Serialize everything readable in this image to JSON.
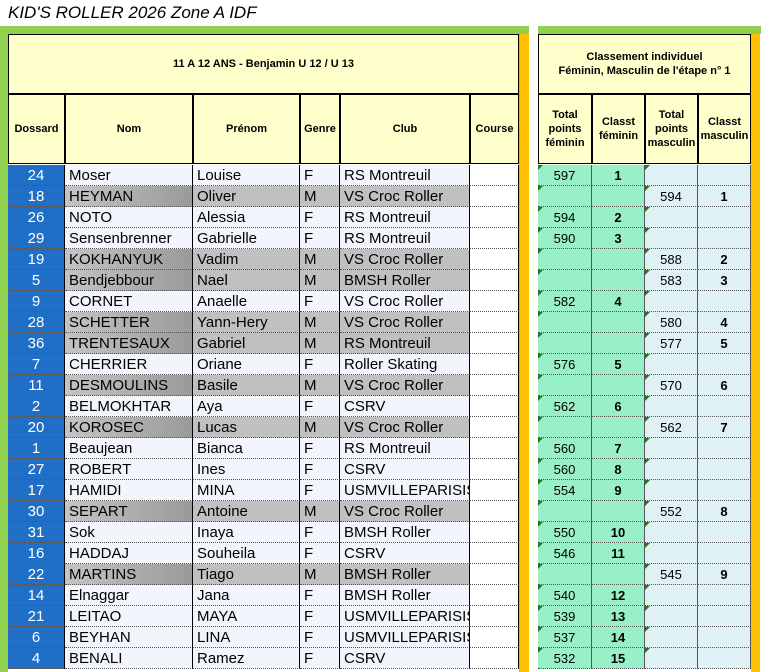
{
  "page_title": "KID'S ROLLER 2026 Zone A IDF",
  "category_header": "11 A 12 ANS - Benjamin   U 12 / U 13",
  "ranking_header": {
    "line1": "Classement individuel",
    "line2": "Féminin, Masculin de l'étape n° 1"
  },
  "columns": {
    "dossard": "Dossard",
    "nom": "Nom",
    "prenom": "Prénom",
    "genre": "Genre",
    "club": "Club",
    "course": "Course",
    "total_fem": "Total points féminin",
    "classt_fem": "Classt féminin",
    "total_masc": "Total points masculin",
    "classt_masc": "Classt masculin"
  },
  "colors": {
    "dossard_bg": "#1f6fc6",
    "header_bg": "#ffffcc",
    "fem_bg": "#99f0c8",
    "masc_bg": "#dff1f4",
    "male_row_bg": "#c0c0c0",
    "female_row_bg": "#f2f6fc",
    "green_frame": "#92d050",
    "orange_frame": "#ffc000"
  },
  "rows": [
    {
      "dossard": "24",
      "nom": "Moser",
      "prenom": "Louise",
      "genre": "F",
      "club": "RS Montreuil",
      "total_f": "597",
      "classt_f": "1",
      "total_m": "",
      "classt_m": ""
    },
    {
      "dossard": "18",
      "nom": "HEYMAN",
      "prenom": "Oliver",
      "genre": "M",
      "club": "VS Croc Roller",
      "total_f": "",
      "classt_f": "",
      "total_m": "594",
      "classt_m": "1"
    },
    {
      "dossard": "26",
      "nom": "NOTO",
      "prenom": "Alessia",
      "genre": "F",
      "club": "RS Montreuil",
      "total_f": "594",
      "classt_f": "2",
      "total_m": "",
      "classt_m": ""
    },
    {
      "dossard": "29",
      "nom": "Sensenbrenner",
      "prenom": "Gabrielle",
      "genre": "F",
      "club": "RS Montreuil",
      "total_f": "590",
      "classt_f": "3",
      "total_m": "",
      "classt_m": ""
    },
    {
      "dossard": "19",
      "nom": "KOKHANYUK",
      "prenom": "Vadim",
      "genre": "M",
      "club": "VS Croc Roller",
      "total_f": "",
      "classt_f": "",
      "total_m": "588",
      "classt_m": "2"
    },
    {
      "dossard": "5",
      "nom": "Bendjebbour",
      "prenom": "Nael",
      "genre": "M",
      "club": "BMSH Roller",
      "total_f": "",
      "classt_f": "",
      "total_m": "583",
      "classt_m": "3"
    },
    {
      "dossard": "9",
      "nom": "CORNET",
      "prenom": "Anaelle",
      "genre": "F",
      "club": "VS Croc Roller",
      "total_f": "582",
      "classt_f": "4",
      "total_m": "",
      "classt_m": ""
    },
    {
      "dossard": "28",
      "nom": "SCHETTER",
      "prenom": "Yann-Hery",
      "genre": "M",
      "club": "VS Croc Roller",
      "total_f": "",
      "classt_f": "",
      "total_m": "580",
      "classt_m": "4"
    },
    {
      "dossard": "36",
      "nom": "TRENTESAUX",
      "prenom": "Gabriel",
      "genre": "M",
      "club": "RS Montreuil",
      "total_f": "",
      "classt_f": "",
      "total_m": "577",
      "classt_m": "5"
    },
    {
      "dossard": "7",
      "nom": "CHERRIER",
      "prenom": "Oriane",
      "genre": "F",
      "club": "Roller Skating",
      "total_f": "576",
      "classt_f": "5",
      "total_m": "",
      "classt_m": ""
    },
    {
      "dossard": "11",
      "nom": "DESMOULINS",
      "prenom": "Basile",
      "genre": "M",
      "club": "VS Croc Roller",
      "total_f": "",
      "classt_f": "",
      "total_m": "570",
      "classt_m": "6"
    },
    {
      "dossard": "2",
      "nom": "BELMOKHTAR",
      "prenom": "Aya",
      "genre": "F",
      "club": "CSRV",
      "total_f": "562",
      "classt_f": "6",
      "total_m": "",
      "classt_m": ""
    },
    {
      "dossard": "20",
      "nom": "KOROSEC",
      "prenom": "Lucas",
      "genre": "M",
      "club": "VS Croc Roller",
      "total_f": "",
      "classt_f": "",
      "total_m": "562",
      "classt_m": "7"
    },
    {
      "dossard": "1",
      "nom": "Beaujean",
      "prenom": "Bianca",
      "genre": "F",
      "club": "RS Montreuil",
      "total_f": "560",
      "classt_f": "7",
      "total_m": "",
      "classt_m": ""
    },
    {
      "dossard": "27",
      "nom": "ROBERT",
      "prenom": "Ines",
      "genre": "F",
      "club": "CSRV",
      "total_f": "560",
      "classt_f": "8",
      "total_m": "",
      "classt_m": ""
    },
    {
      "dossard": "17",
      "nom": "HAMIDI",
      "prenom": "MINA",
      "genre": "F",
      "club": "USMVILLEPARISIS",
      "total_f": "554",
      "classt_f": "9",
      "total_m": "",
      "classt_m": ""
    },
    {
      "dossard": "30",
      "nom": "SEPART",
      "prenom": "Antoine",
      "genre": "M",
      "club": "VS Croc Roller",
      "total_f": "",
      "classt_f": "",
      "total_m": "552",
      "classt_m": "8"
    },
    {
      "dossard": "31",
      "nom": "Sok",
      "prenom": "Inaya",
      "genre": "F",
      "club": "BMSH Roller",
      "total_f": "550",
      "classt_f": "10",
      "total_m": "",
      "classt_m": ""
    },
    {
      "dossard": "16",
      "nom": "HADDAJ",
      "prenom": "Souheila",
      "genre": "F",
      "club": "CSRV",
      "total_f": "546",
      "classt_f": "11",
      "total_m": "",
      "classt_m": ""
    },
    {
      "dossard": "22",
      "nom": "MARTINS",
      "prenom": "Tiago",
      "genre": "M",
      "club": "BMSH Roller",
      "total_f": "",
      "classt_f": "",
      "total_m": "545",
      "classt_m": "9"
    },
    {
      "dossard": "14",
      "nom": "Elnaggar",
      "prenom": "Jana",
      "genre": "F",
      "club": "BMSH Roller",
      "total_f": "540",
      "classt_f": "12",
      "total_m": "",
      "classt_m": ""
    },
    {
      "dossard": "21",
      "nom": "LEITAO",
      "prenom": "MAYA",
      "genre": "F",
      "club": "USMVILLEPARISIS",
      "total_f": "539",
      "classt_f": "13",
      "total_m": "",
      "classt_m": ""
    },
    {
      "dossard": "6",
      "nom": "BEYHAN",
      "prenom": "LINA",
      "genre": "F",
      "club": "USMVILLEPARISIS",
      "total_f": "537",
      "classt_f": "14",
      "total_m": "",
      "classt_m": ""
    },
    {
      "dossard": "4",
      "nom": "BENALI",
      "prenom": "Ramez",
      "genre": "F",
      "club": "CSRV",
      "total_f": "532",
      "classt_f": "15",
      "total_m": "",
      "classt_m": ""
    }
  ]
}
